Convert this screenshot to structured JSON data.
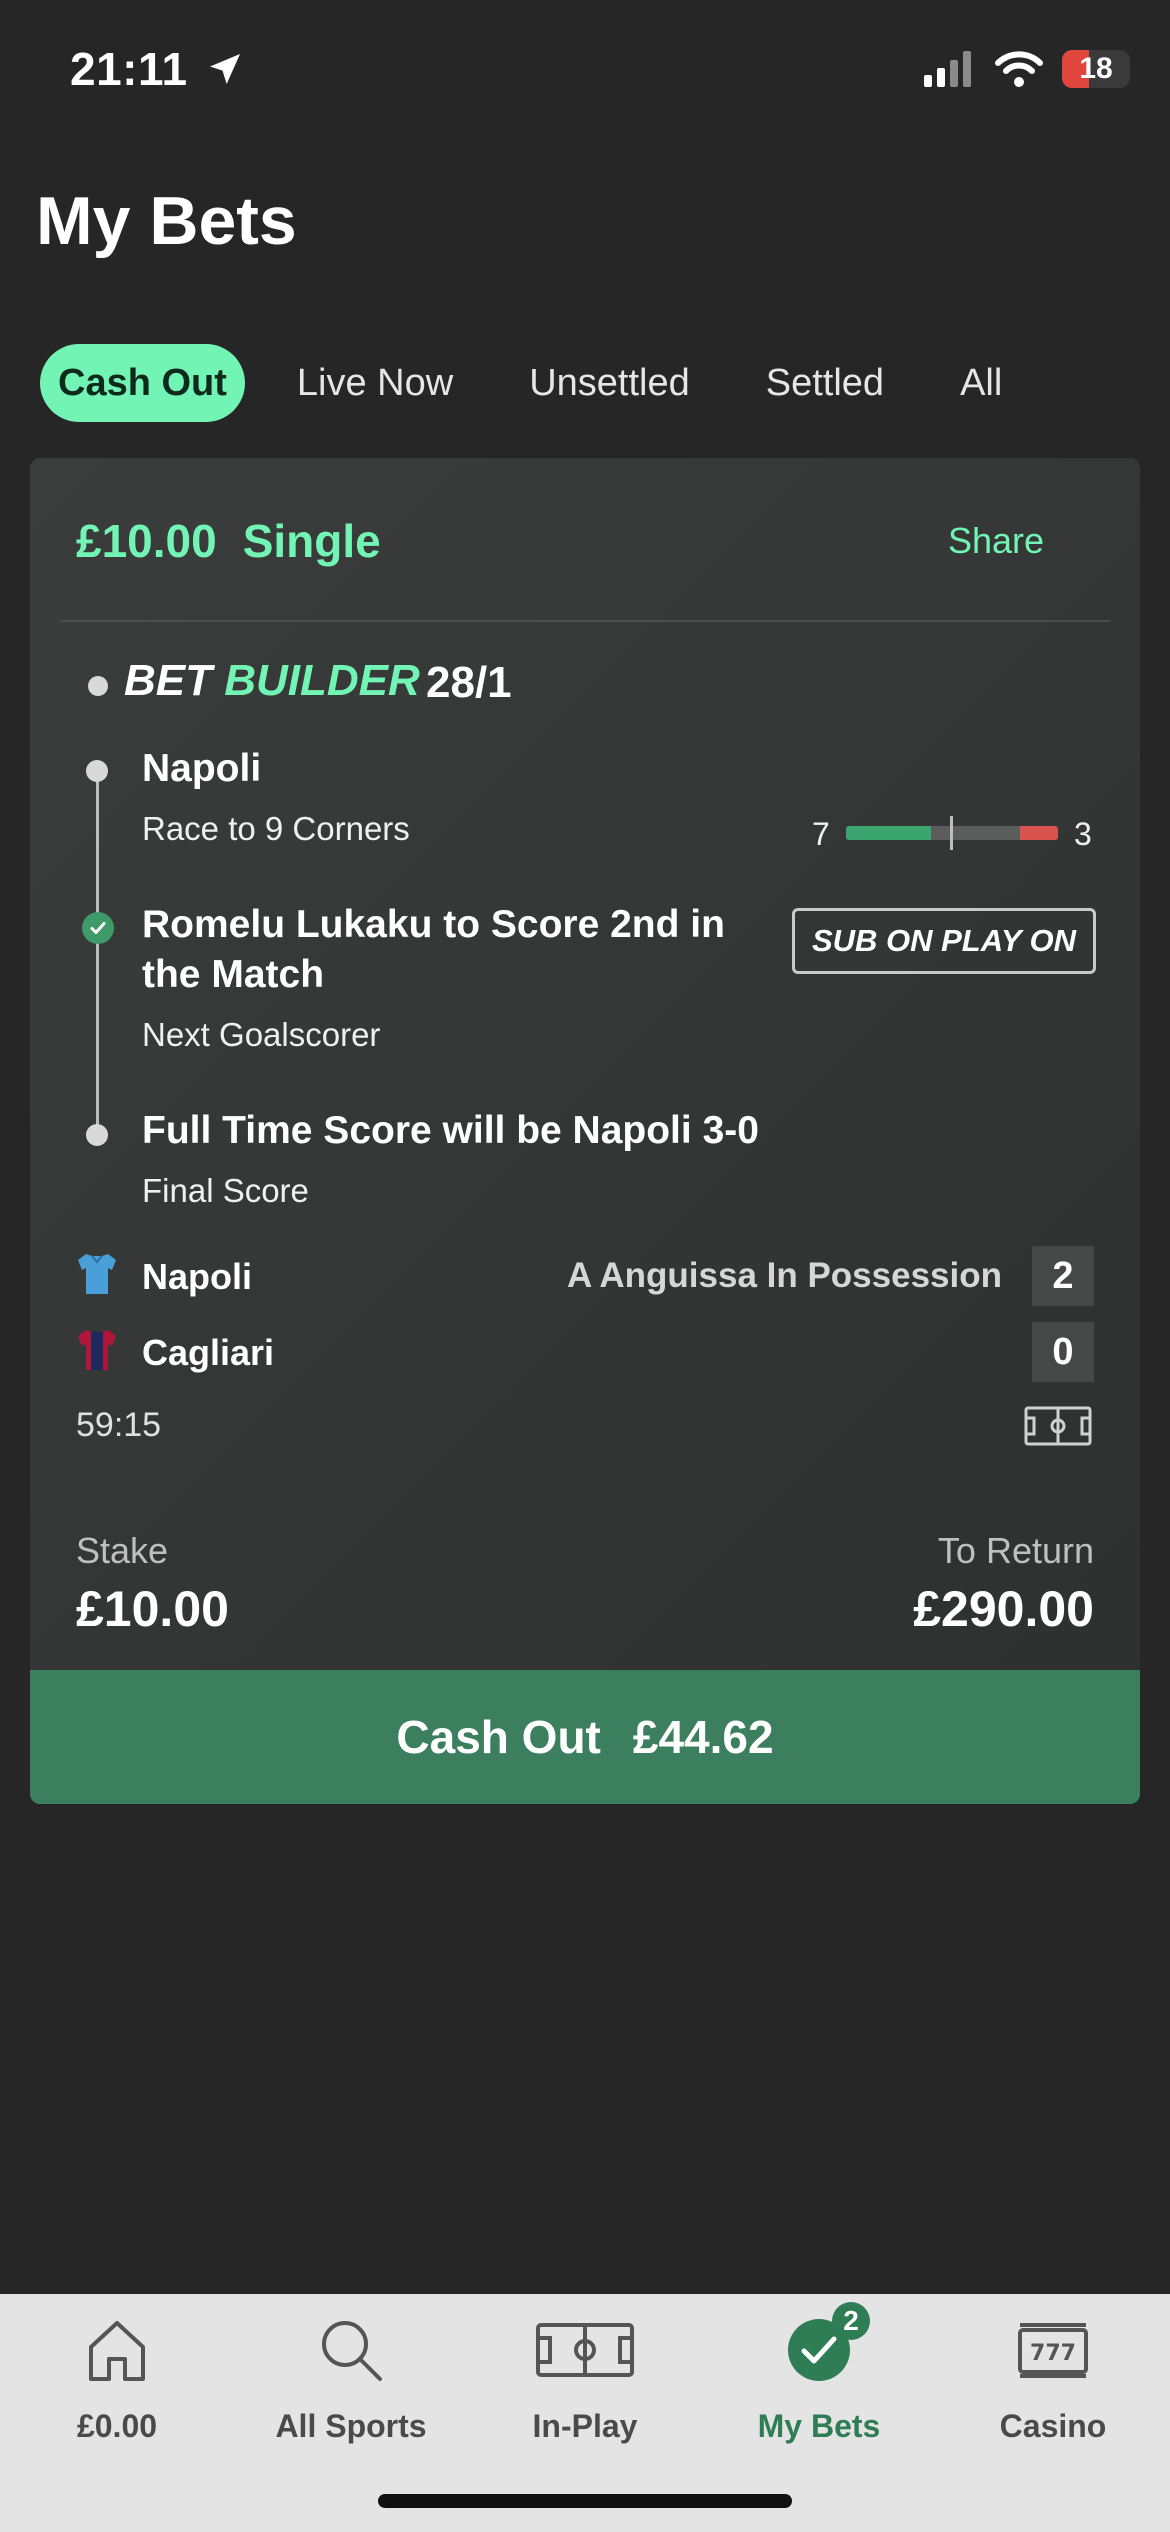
{
  "status_bar": {
    "time": "21:11",
    "battery": "18"
  },
  "page": {
    "title": "My Bets"
  },
  "tabs": [
    {
      "label": "Cash Out",
      "active": true
    },
    {
      "label": "Live Now"
    },
    {
      "label": "Unsettled"
    },
    {
      "label": "Settled"
    },
    {
      "label": "All"
    }
  ],
  "bet": {
    "stake_amount": "£10.00",
    "bet_type": "Single",
    "share_label": "Share",
    "builder_prefix": "BET",
    "builder_word": "BUILDER",
    "odds": "28/1",
    "legs": [
      {
        "title": "Napoli",
        "subtitle": "Race to 9 Corners",
        "status": "open"
      },
      {
        "title_line1": "Romelu Lukaku to Score 2nd in",
        "title_line2": "the Match",
        "subtitle": "Next Goalscorer",
        "status": "won",
        "badge": "SUB ON PLAY ON"
      },
      {
        "title": "Full Time Score will be Napoli 3-0",
        "subtitle": "Final Score",
        "status": "open"
      }
    ],
    "corners": {
      "home": "7",
      "away": "3",
      "home_progress": 0.4,
      "away_progress": 0.18
    },
    "match": {
      "home_team": "Napoli",
      "away_team": "Cagliari",
      "home_score": "2",
      "away_score": "0",
      "possession": "A Anguissa In Possession",
      "clock": "59:15"
    },
    "stake_label": "Stake",
    "stake_value": "£10.00",
    "return_label": "To Return",
    "return_value": "£290.00",
    "cashout_label": "Cash Out",
    "cashout_value": "£44.62"
  },
  "bottom_nav": [
    {
      "label": "£0.00",
      "icon": "home-icon"
    },
    {
      "label": "All Sports",
      "icon": "search-icon"
    },
    {
      "label": "In-Play",
      "icon": "pitch-icon"
    },
    {
      "label": "My Bets",
      "icon": "check-icon",
      "badge": "2",
      "active": true
    },
    {
      "label": "Casino",
      "icon": "slot-machine-icon"
    }
  ],
  "colors": {
    "accent": "#72f5b4",
    "cashout": "#3c7f5e",
    "nav_active": "#2f7d55"
  }
}
